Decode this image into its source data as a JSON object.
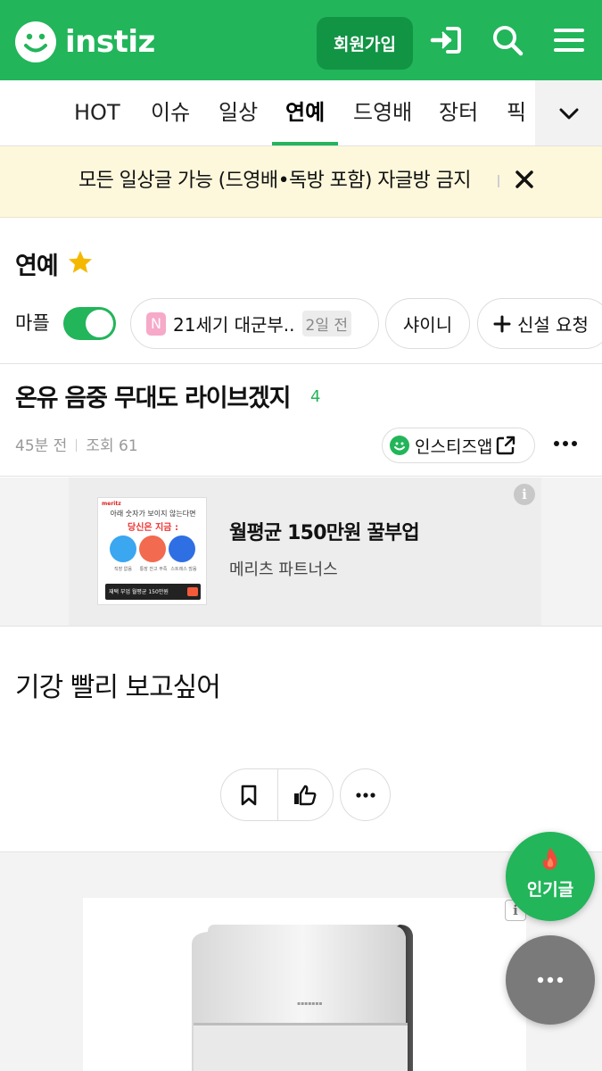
{
  "header": {
    "logo_text": "instiz",
    "join_label": "회원가입",
    "brand_color": "#22b55a",
    "icons": [
      "login-icon",
      "search-icon",
      "menu-icon"
    ]
  },
  "tabs": {
    "items": [
      "HOT",
      "이슈",
      "일상",
      "연예",
      "드영배",
      "장터",
      "픽"
    ],
    "active": "연예"
  },
  "notice": {
    "text": "모든 일상글 가능 (드영배•독방 포함) 자글방 금지"
  },
  "board": {
    "title": "연예",
    "mapl_label": "마플",
    "mapl_on": true,
    "chips": [
      {
        "icon": "N",
        "label": "21세기 대군부..",
        "badge": "2일 전"
      },
      {
        "label": "샤이니"
      },
      {
        "label": "신설 요청"
      }
    ]
  },
  "post": {
    "title": "온유 음중 무대도 라이브겠지",
    "comment_count": "4",
    "time": "45분 전",
    "views": "조회 61",
    "app_button": "인스티즈앱",
    "body": "기강 빨리 보고싶어"
  },
  "ad1": {
    "title": "월평균 150만원 꿀부업",
    "subtitle": "메리츠 파트너스",
    "thumb_brand": "meritz",
    "thumb_heading": "아래 숫자가 보이지 않는다면",
    "thumb_highlight": "당신은 지금 :",
    "thumb_circles": [
      "직장 없음",
      "통장 잔고 부족",
      "스트레스 많음"
    ],
    "thumb_banner": "재택 부업 월평균 150만원"
  },
  "floating": {
    "hot_label": "인기글"
  }
}
